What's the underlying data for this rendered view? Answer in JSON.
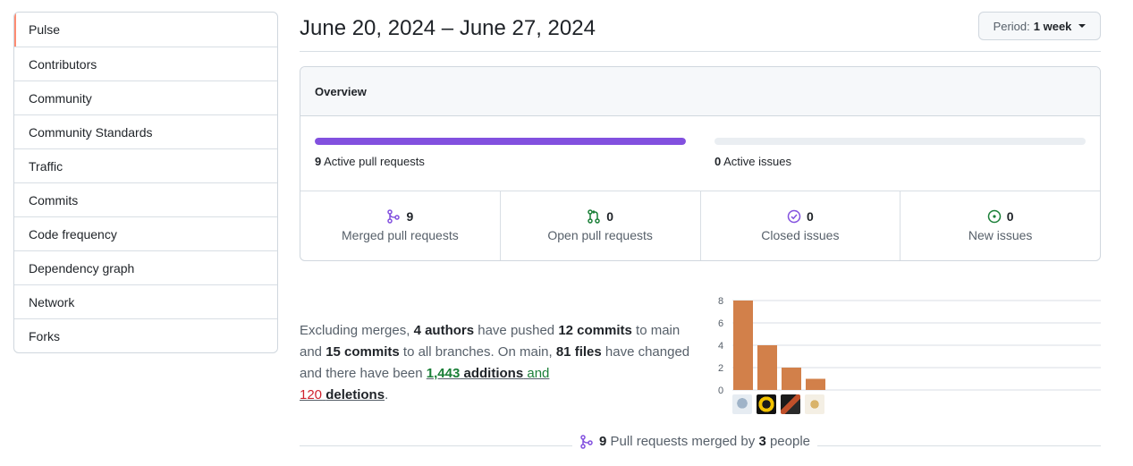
{
  "sidebar": {
    "items": [
      {
        "label": "Pulse",
        "selected": true
      },
      {
        "label": "Contributors"
      },
      {
        "label": "Community"
      },
      {
        "label": "Community Standards"
      },
      {
        "label": "Traffic"
      },
      {
        "label": "Commits"
      },
      {
        "label": "Code frequency"
      },
      {
        "label": "Dependency graph"
      },
      {
        "label": "Network"
      },
      {
        "label": "Forks"
      }
    ]
  },
  "header": {
    "date_range": "June 20, 2024 – June 27, 2024",
    "period_prefix": "Period:",
    "period_value": "1 week"
  },
  "overview": {
    "title": "Overview",
    "pull_requests": {
      "count": "9",
      "label": "Active pull requests",
      "fill_fraction": 1.0
    },
    "issues": {
      "count": "0",
      "label": "Active issues",
      "fill_fraction": 0.0
    },
    "stats": [
      {
        "count": "9",
        "label": "Merged pull requests",
        "icon": "git-merge-icon",
        "color": "#8250df"
      },
      {
        "count": "0",
        "label": "Open pull requests",
        "icon": "git-pull-request-icon",
        "color": "#1a7f37"
      },
      {
        "count": "0",
        "label": "Closed issues",
        "icon": "issue-closed-icon",
        "color": "#8250df"
      },
      {
        "count": "0",
        "label": "New issues",
        "icon": "issue-opened-icon",
        "color": "#1a7f37"
      }
    ]
  },
  "summary": {
    "t1": "Excluding merges, ",
    "authors": "4 authors",
    "t2": " have pushed ",
    "commits_main": "12 commits",
    "t3": " to main and ",
    "commits_all": "15 commits",
    "t4": " to all branches. On main, ",
    "files": "81 files",
    "t5": " have changed and there have been ",
    "additions_num": "1,443",
    "additions_word": "additions",
    "t6": " and",
    "deletions_num": "120",
    "deletions_word": "deletions",
    "t7": "."
  },
  "chart_data": {
    "type": "bar",
    "categories": [
      "author-1",
      "author-2",
      "author-3",
      "author-4"
    ],
    "values": [
      8,
      4,
      2,
      1
    ],
    "yticks": [
      "0",
      "2",
      "4",
      "6",
      "8"
    ],
    "ylim": [
      0,
      8
    ],
    "bar_color": "#d2804a",
    "grid": true
  },
  "footer": {
    "count": "9",
    "t1": "Pull requests merged by",
    "people": "3",
    "t2": "people"
  }
}
